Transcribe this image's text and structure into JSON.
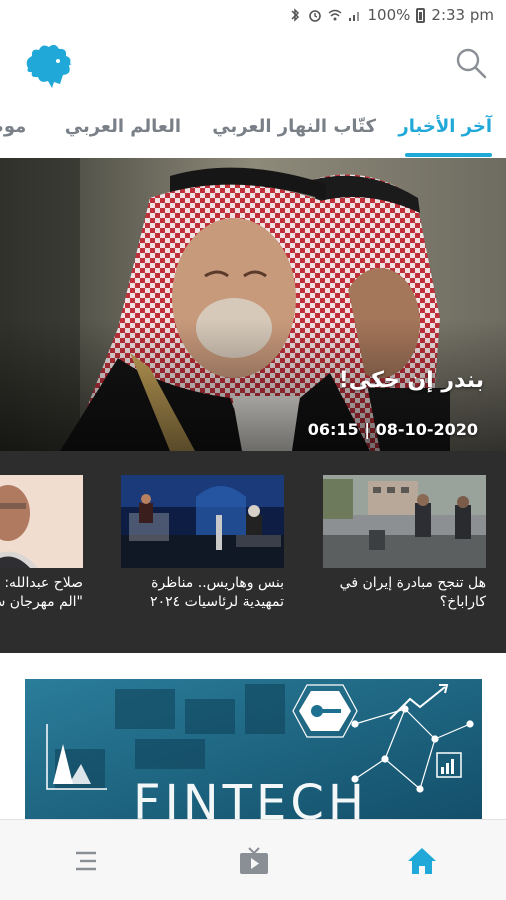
{
  "status_bar": {
    "battery": "100%",
    "time": "2:33 pm"
  },
  "tabs": [
    {
      "label": "آخر الأخبار",
      "active": true
    },
    {
      "label": "كتّاب النهار العربي",
      "active": false
    },
    {
      "label": "العالم العربي",
      "active": false
    },
    {
      "label": "موضوعات",
      "active": false
    }
  ],
  "hero": {
    "title": "بندر إن حكى!",
    "date": "06:15 | 08-10-2020"
  },
  "cards": [
    {
      "title": "هل تنجح مبادرة إيران في كاراباخ؟"
    },
    {
      "title": "بنس وهاريس.. مناظرة تمهيدية لرئاسيات ٢٠٢٤"
    },
    {
      "title": "صلاح عبدالله: \"العربي\"، \"الم مهرجان سي"
    }
  ],
  "banner": {
    "text": "FINTECH"
  },
  "colors": {
    "accent": "#20a8d8",
    "tab_inactive": "#7a8088",
    "carousel_bg": "#2d2d2d"
  },
  "icons": {
    "logo": "rooster-logo",
    "search": "search-icon",
    "menu": "menu-icon",
    "tv": "tv-icon",
    "home": "home-icon"
  }
}
